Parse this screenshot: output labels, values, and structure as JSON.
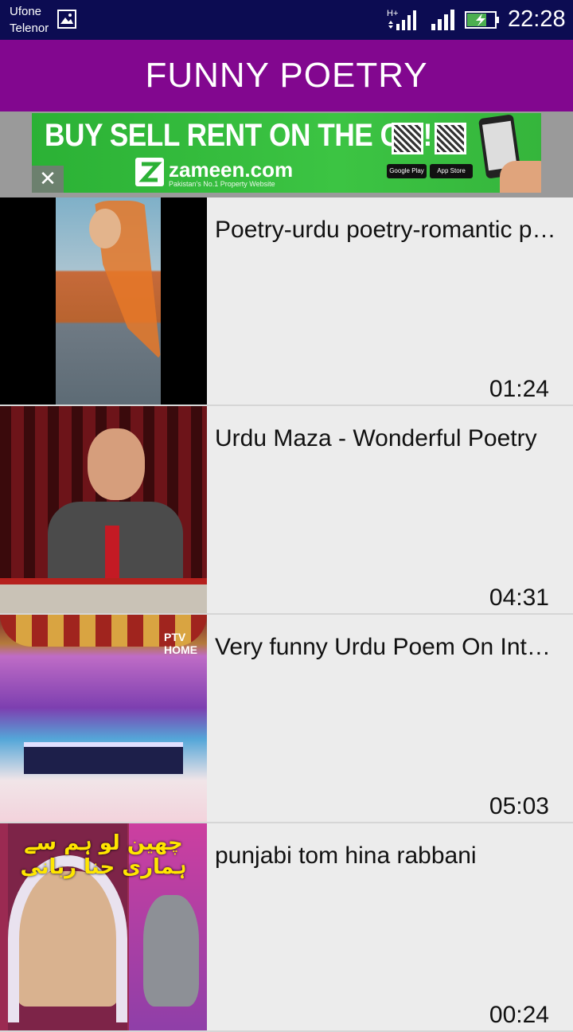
{
  "status_bar": {
    "carrier_1": "Ufone",
    "carrier_2": "Telenor",
    "network_type": "H+",
    "time": "22:28"
  },
  "app_bar": {
    "title": "FUNNY POETRY",
    "color": "#82078f"
  },
  "ad": {
    "headline": "BUY SELL RENT ON THE GO!",
    "brand": "zameen.com",
    "tagline": "Pakistan's No.1 Property Website",
    "store_1": "Google Play",
    "store_2": "App Store",
    "close_symbol": "✕"
  },
  "videos": [
    {
      "title": "Poetry-urdu poetry-romantic poetry",
      "duration": "01:24"
    },
    {
      "title": "Urdu Maza - Wonderful Poetry",
      "duration": "04:31"
    },
    {
      "title": "Very funny Urdu Poem On Internet",
      "duration": "05:03"
    },
    {
      "title": "punjabi tom hina rabbani",
      "duration": "00:24"
    }
  ],
  "thumb_text": {
    "urdu_caption": "چھین لو ہم سے ہماری حنا ربانی",
    "channel_logo": "PTV HOME"
  }
}
